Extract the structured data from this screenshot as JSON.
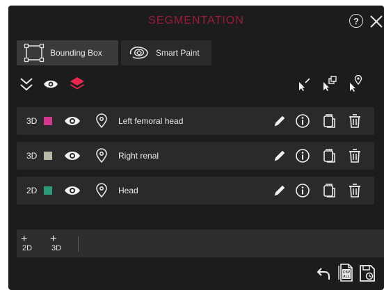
{
  "header": {
    "title": "SEGMENTATION",
    "help_icon": "?",
    "close_icon": "close-icon"
  },
  "tools": [
    {
      "label": "Bounding Box",
      "icon": "bounding-box-icon",
      "active": true
    },
    {
      "label": "Smart Paint",
      "icon": "smart-paint-icon",
      "active": false
    }
  ],
  "toolbar": {
    "left_icons": [
      "collapse-all-icon",
      "eye-icon",
      "layers-icon"
    ],
    "right_icons": [
      "select-cursor-icon",
      "select-copy-icon",
      "select-location-icon"
    ],
    "accent": "#e8274d"
  },
  "segments": [
    {
      "dim": "3D",
      "color": "#d4388e",
      "label": "Left femoral head"
    },
    {
      "dim": "3D",
      "color": "#b8b8a4",
      "label": "Right renal"
    },
    {
      "dim": "2D",
      "color": "#2e9a7c",
      "label": "Head"
    }
  ],
  "add_bar": {
    "add_2d": {
      "plus": "+",
      "dim": "2D"
    },
    "add_3d": {
      "plus": "+",
      "dim": "3D"
    }
  },
  "footer": {
    "icons": [
      "undo-icon",
      "export-csv-icon",
      "save-icon"
    ],
    "csv_label": "CSV",
    "all_label": "ALL"
  },
  "colors": {
    "panel_bg": "#1c1c1c",
    "row_bg": "#2a2a2a",
    "title": "#9a1b3a"
  }
}
